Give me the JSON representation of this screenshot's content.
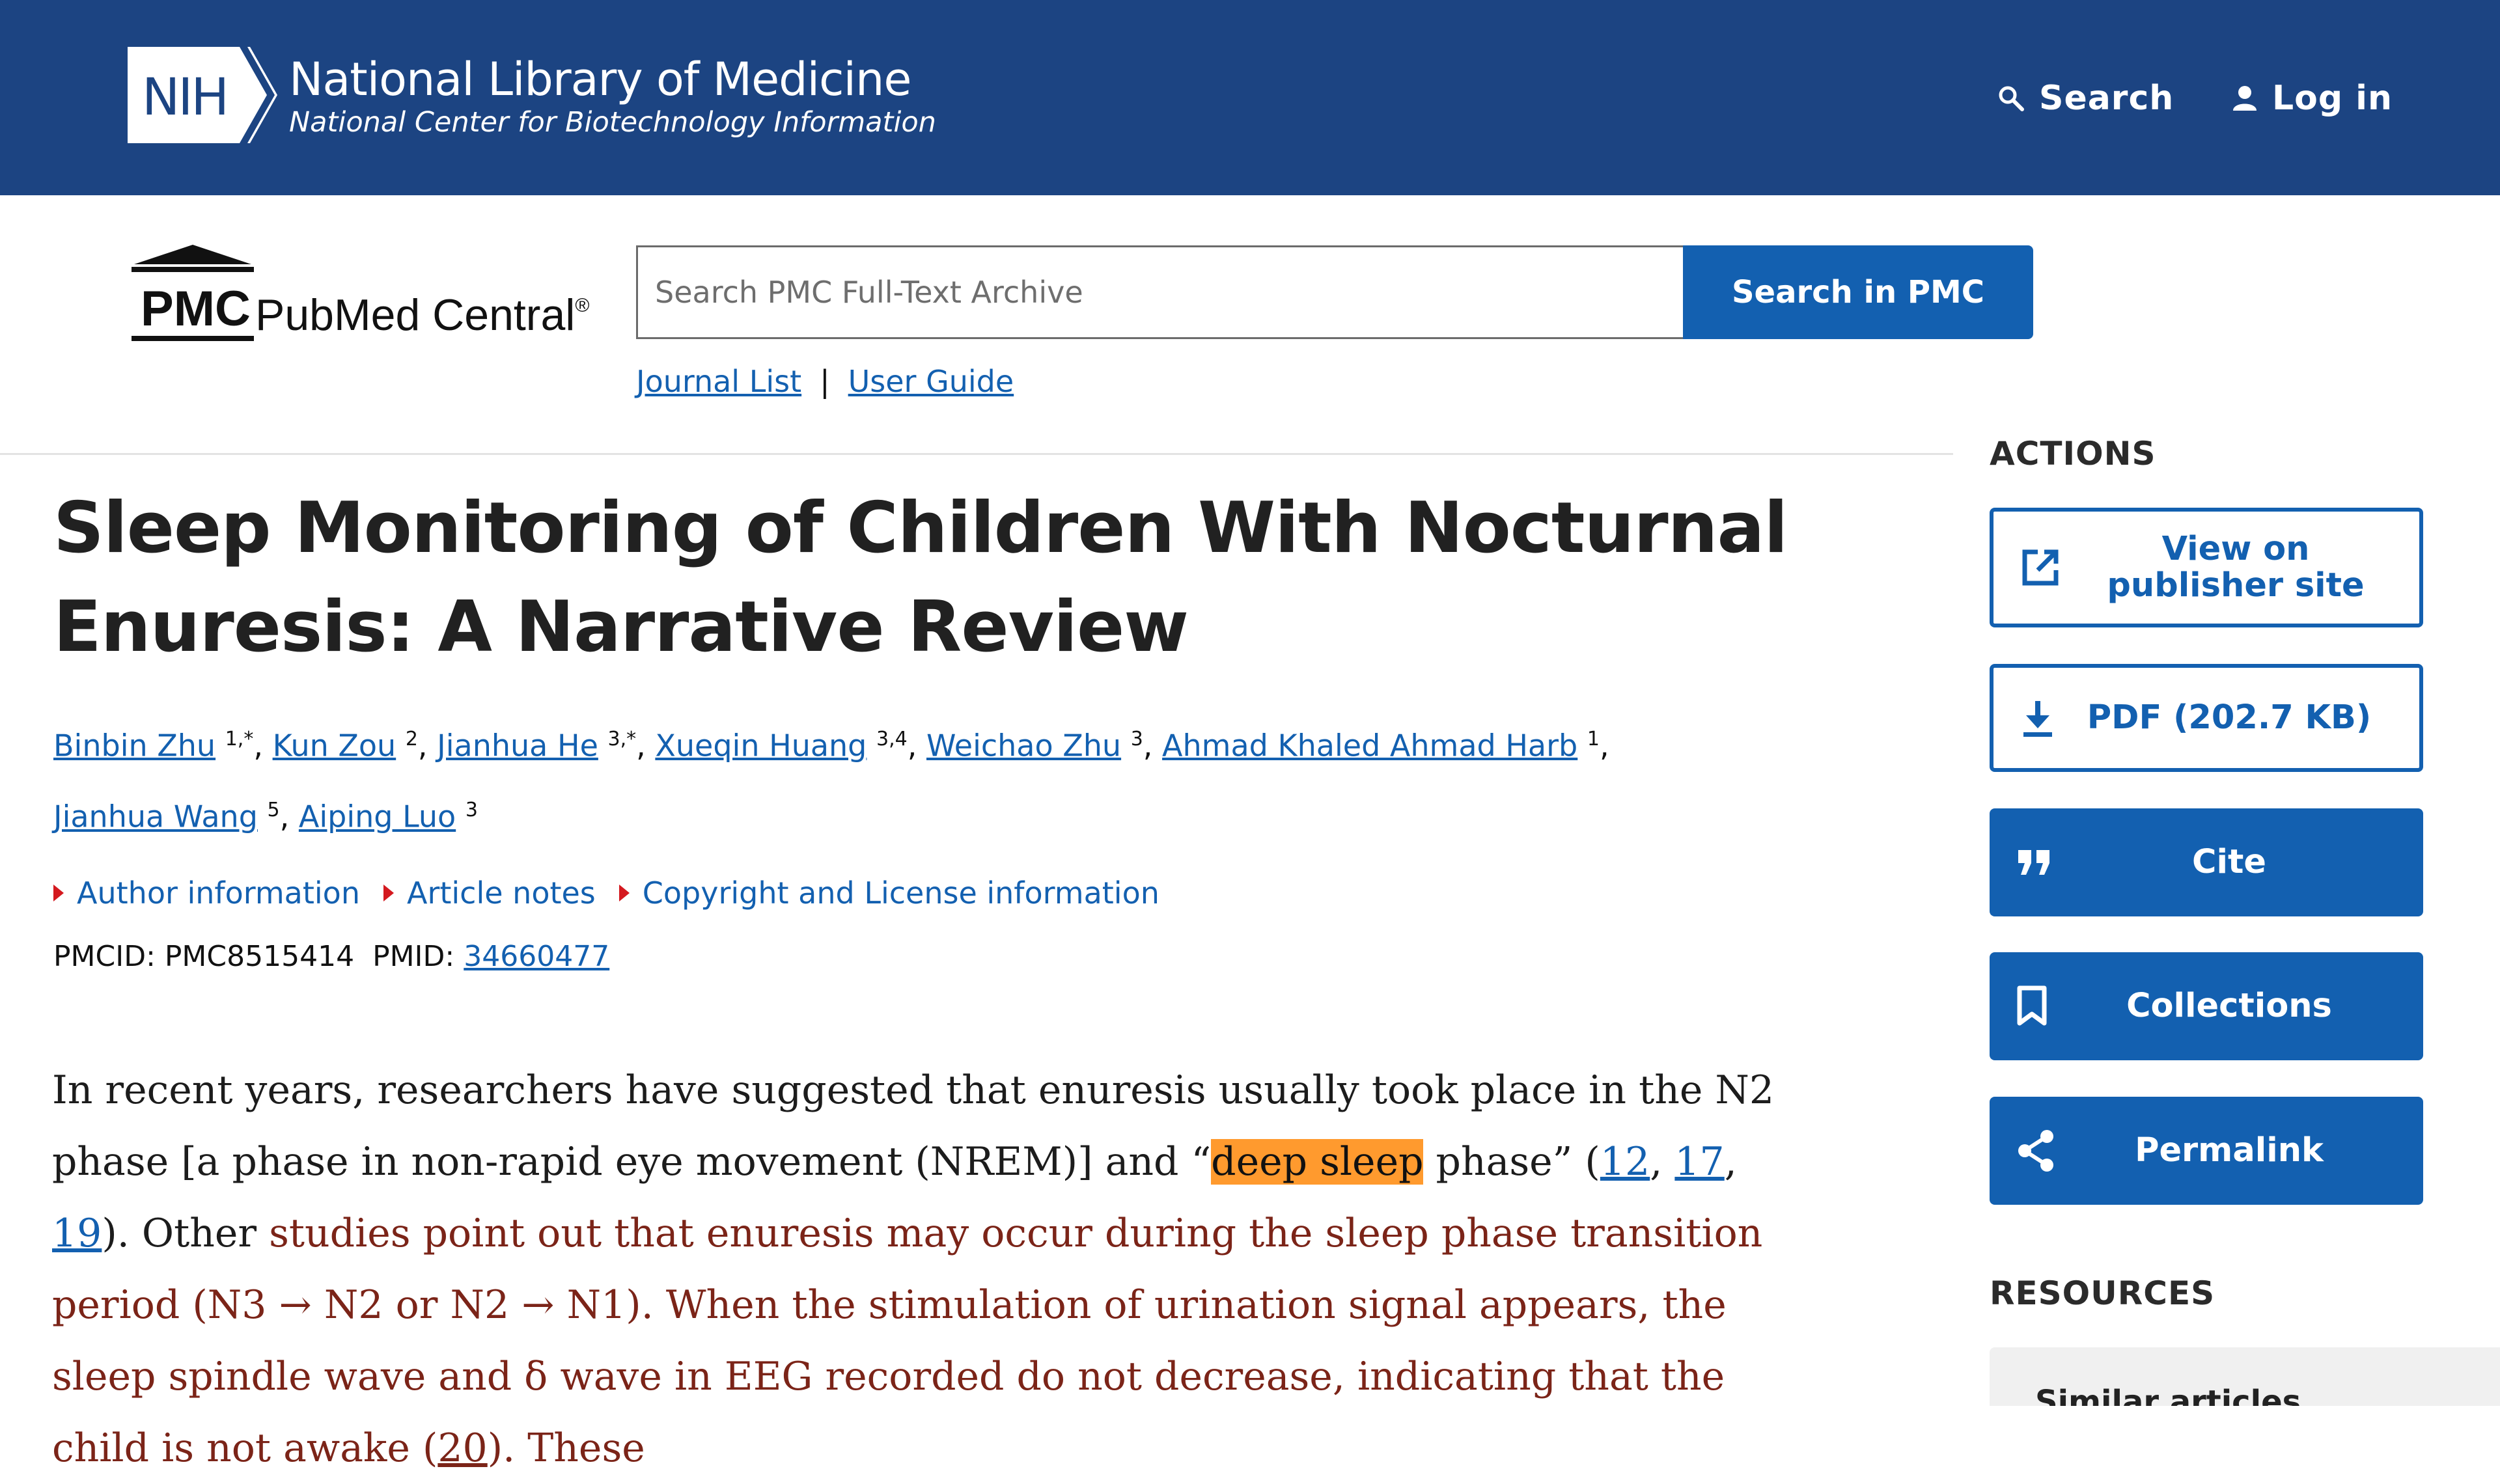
{
  "banner": {
    "logo_text": "NIH",
    "title": "National Library of Medicine",
    "subtitle": "National Center for Biotechnology Information",
    "search_label": "Search",
    "login_label": "Log in"
  },
  "pmc": {
    "logo_text": "PMC",
    "name": "PubMed Central",
    "registered": "®",
    "search_placeholder": "Search PMC Full-Text Archive",
    "search_button": "Search in PMC",
    "journal_list": "Journal List",
    "separator": "|",
    "user_guide": "User Guide"
  },
  "article": {
    "title": "Sleep Monitoring of Children With Nocturnal Enuresis: A Narrative Review",
    "authors": [
      {
        "name": "Binbin Zhu",
        "sup": "1,*"
      },
      {
        "name": "Kun Zou",
        "sup": "2"
      },
      {
        "name": "Jianhua He",
        "sup": "3,*"
      },
      {
        "name": "Xueqin Huang",
        "sup": "3,4"
      },
      {
        "name": "Weichao Zhu",
        "sup": "3"
      },
      {
        "name": "Ahmad Khaled Ahmad Harb",
        "sup": "1"
      },
      {
        "name": "Jianhua Wang",
        "sup": "5"
      },
      {
        "name": "Aiping Luo",
        "sup": "3"
      }
    ],
    "toggles": [
      "Author information",
      "Article notes",
      "Copyright and License information"
    ],
    "pmcid_label": "PMCID: PMC8515414",
    "pmid_label": "PMID:",
    "pmid_value": "34660477",
    "body": {
      "s1": "In recent years, researchers have suggested that enuresis usually took place in the N2 phase [a phase in non-rapid eye movement (NREM)] and “",
      "highlight": "deep sleep",
      "s2": " phase” (",
      "ref1": "12",
      "ref2": "17",
      "ref3": "19",
      "s3": "). Other",
      "red1": " studies point out that enuresis may occur during the sleep phase transition period (N3 → N2 or N2 → N1). When the stimulation of urination signal appears, the sleep spindle wave and δ wave in EEG recorded do not decrease, indicating that the child is not awake (",
      "ref4": "20",
      "red2": "). These"
    }
  },
  "sidebar": {
    "actions_heading": "ACTIONS",
    "view_publisher": "View on publisher site",
    "pdf": "PDF (202.7 KB)",
    "cite": "Cite",
    "collections": "Collections",
    "permalink": "Permalink",
    "resources_heading": "RESOURCES",
    "similar_articles": "Similar articles"
  },
  "colors": {
    "banner_bg": "#1c4482",
    "primary_blue": "#1360b0",
    "highlight": "#ff9a2e",
    "caret_red": "#d4191f",
    "body_red_text": "#7b2418"
  }
}
